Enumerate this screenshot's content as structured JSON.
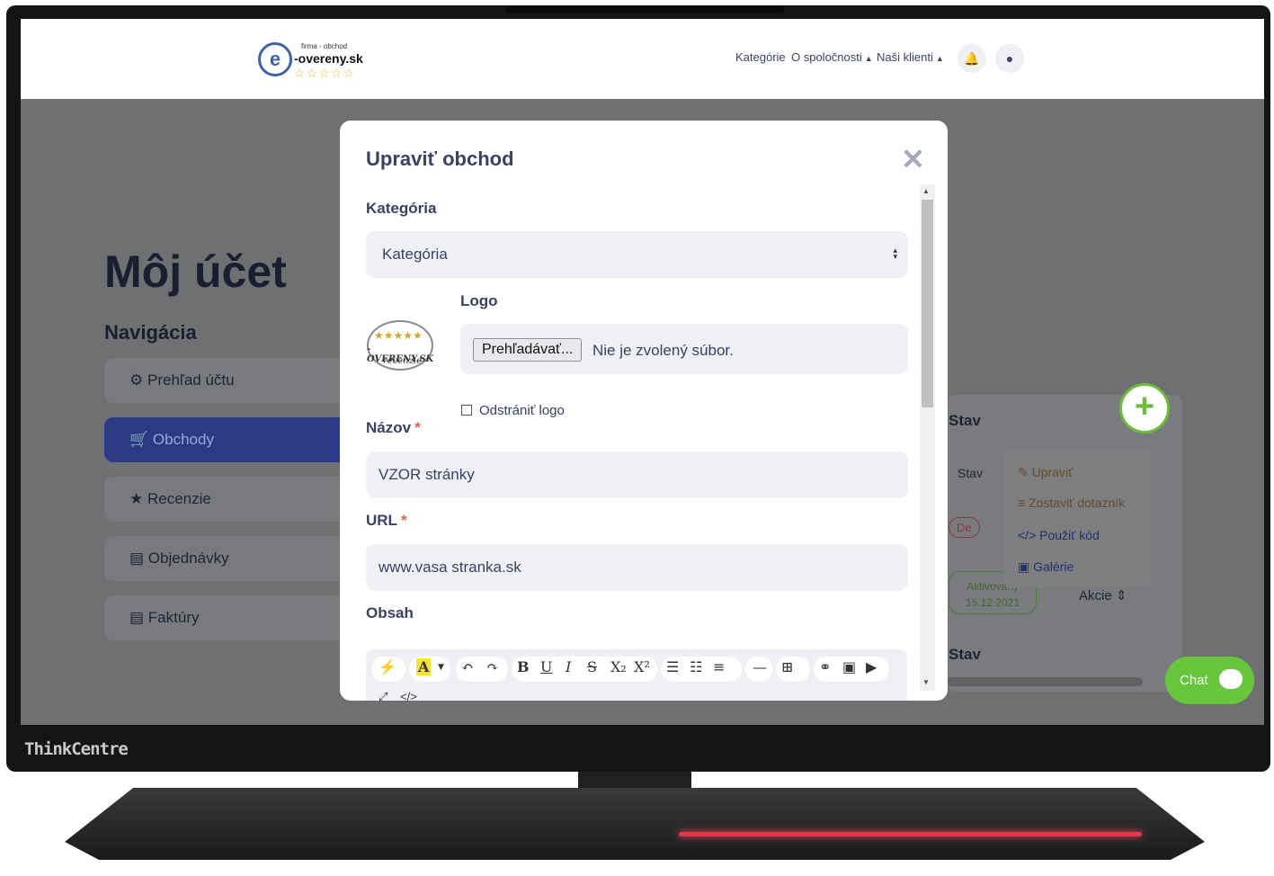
{
  "header": {
    "logo": {
      "tagline": "firma - obchod",
      "name": "-overeny.sk",
      "stars": "☆☆☆☆☆"
    },
    "nav": [
      {
        "label": "Kategórie"
      },
      {
        "label": "O spoločnosti"
      },
      {
        "label": "Naši klienti"
      }
    ]
  },
  "page": {
    "title": "Môj účet",
    "nav_title": "Navigácia",
    "sidebar": [
      {
        "icon": "⚙",
        "label": "Prehľad účtu"
      },
      {
        "icon": "🛒",
        "label": "Obchody"
      },
      {
        "icon": "★",
        "label": "Recenzie"
      },
      {
        "icon": "▤",
        "label": "Objednávky"
      },
      {
        "icon": "▤",
        "label": "Faktúry"
      }
    ],
    "card": {
      "stav_heading": "Stav",
      "stav_small": "Stav",
      "badge_inactive": "De",
      "badge_active_line1": "Aktivovaný",
      "badge_active_line2": "15.12.2021",
      "akcie": "Akcie",
      "stav_heading_2": "Stav"
    },
    "menu": [
      {
        "label": "Upraviť",
        "color": "#8a5a2a"
      },
      {
        "label": "Zostaviť dotazník",
        "color": "#8a5a2a"
      },
      {
        "label": "Použiť kód",
        "color": "#2c3a86"
      },
      {
        "label": "Galérie",
        "color": "#2c3a86"
      }
    ],
    "chat_label": "Chat"
  },
  "modal": {
    "title": "Upraviť obchod",
    "close_symbol": "✕",
    "category_label": "Kategória",
    "category_value": "Kategória",
    "logo_label": "Logo",
    "logo_preview": {
      "stars": "★★★★★",
      "name": "-OVERENY.SK",
      "sub": "recenzie"
    },
    "file_button": "Prehľadávať...",
    "file_status": "Nie je zvolený súbor.",
    "remove_logo_label": "Odstrániť logo",
    "name_label": "Názov",
    "name_value": "VZOR stránky",
    "url_label": "URL",
    "url_value": "www.vasa stranka.sk",
    "content_label": "Obsah",
    "required_mark": "*"
  },
  "device": {
    "brand": "ThinkCentre"
  },
  "colors": {
    "accent": "#2c3a86",
    "chat": "#67c63b",
    "overlay": "#6f7072"
  }
}
